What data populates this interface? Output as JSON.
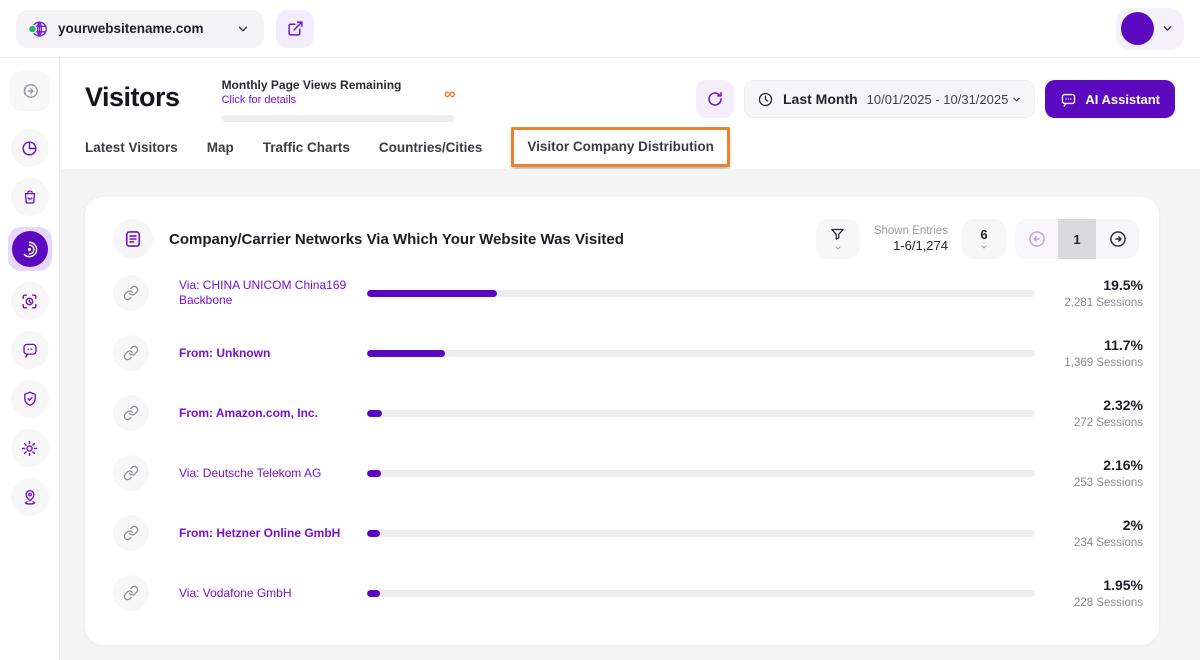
{
  "colors": {
    "accent_purple": "#5C0AC0",
    "link_purple": "#7A10CE",
    "light_purple_bg": "#F3ECFC",
    "highlight_orange": "#E8842F",
    "infinity_orange": "#F4772E",
    "status_green": "#1FB573",
    "page_background_gray": "#F4F4F5",
    "bar_track_gray": "#EDEDEF"
  },
  "topbar": {
    "website_name": "yourwebsitename.com",
    "icons": [
      "globe-icon",
      "chevron-down-icon",
      "external-link-icon",
      "avatar",
      "chevron-down-icon"
    ]
  },
  "sidebar": {
    "items": [
      {
        "icon": "arrow-right-circle-icon",
        "active": false
      },
      {
        "icon": "pie-chart-icon",
        "active": false
      },
      {
        "icon": "shopping-bag-icon",
        "active": false
      },
      {
        "icon": "radar-icon",
        "active": true
      },
      {
        "icon": "focus-clock-icon",
        "active": false
      },
      {
        "icon": "chat-bubble-icon",
        "active": false
      },
      {
        "icon": "shield-check-icon",
        "active": false
      },
      {
        "icon": "gear-icon",
        "active": false
      },
      {
        "icon": "location-pin-icon",
        "active": false
      }
    ]
  },
  "header": {
    "title": "Visitors",
    "quota_title": "Monthly Page Views Remaining",
    "quota_link": "Click for details",
    "quota_value": "∞",
    "period_label": "Last Month",
    "period_range": "10/01/2025 - 10/31/2025",
    "ai_button_label": "AI Assistant"
  },
  "tabs": [
    {
      "label": "Latest Visitors",
      "highlighted": false
    },
    {
      "label": "Map",
      "highlighted": false
    },
    {
      "label": "Traffic Charts",
      "highlighted": false
    },
    {
      "label": "Countries/Cities",
      "highlighted": false
    },
    {
      "label": "Visitor Company Distribution",
      "highlighted": true
    }
  ],
  "card": {
    "title": "Company/Carrier Networks Via Which Your Website Was Visited",
    "shown_entries_label": "Shown Entries",
    "shown_entries_value": "1-6/1,274",
    "page_size": "6",
    "current_page": "1"
  },
  "chart_data": {
    "type": "bar",
    "title": "Company/Carrier Networks Via Which Your Website Was Visited",
    "categories": [
      "Via: CHINA UNICOM China169 Backbone",
      "From: Unknown",
      "From: Amazon.com, Inc.",
      "Via: Deutsche Telekom AG",
      "From: Hetzner Online GmbH",
      "Via: Vodafone GmbH"
    ],
    "values": [
      19.5,
      11.7,
      2.32,
      2.16,
      2.0,
      1.95
    ],
    "value_unit": "percent_of_sessions",
    "xlim": [
      0,
      100
    ],
    "rows": [
      {
        "label": "Via: CHINA UNICOM China169 Backbone",
        "bold": false,
        "bar": 19.5,
        "percent": "19.5%",
        "sessions": "2,281 Sessions"
      },
      {
        "label": "From: Unknown",
        "bold": true,
        "bar": 11.7,
        "percent": "11.7%",
        "sessions": "1,369 Sessions"
      },
      {
        "label": "From: Amazon.com, Inc.",
        "bold": true,
        "bar": 2.32,
        "percent": "2.32%",
        "sessions": "272 Sessions"
      },
      {
        "label": "Via: Deutsche Telekom AG",
        "bold": false,
        "bar": 2.16,
        "percent": "2.16%",
        "sessions": "253 Sessions"
      },
      {
        "label": "From: Hetzner Online GmbH",
        "bold": true,
        "bar": 2.0,
        "percent": "2%",
        "sessions": "234 Sessions"
      },
      {
        "label": "Via: Vodafone GmbH",
        "bold": false,
        "bar": 1.95,
        "percent": "1.95%",
        "sessions": "228 Sessions"
      }
    ]
  }
}
